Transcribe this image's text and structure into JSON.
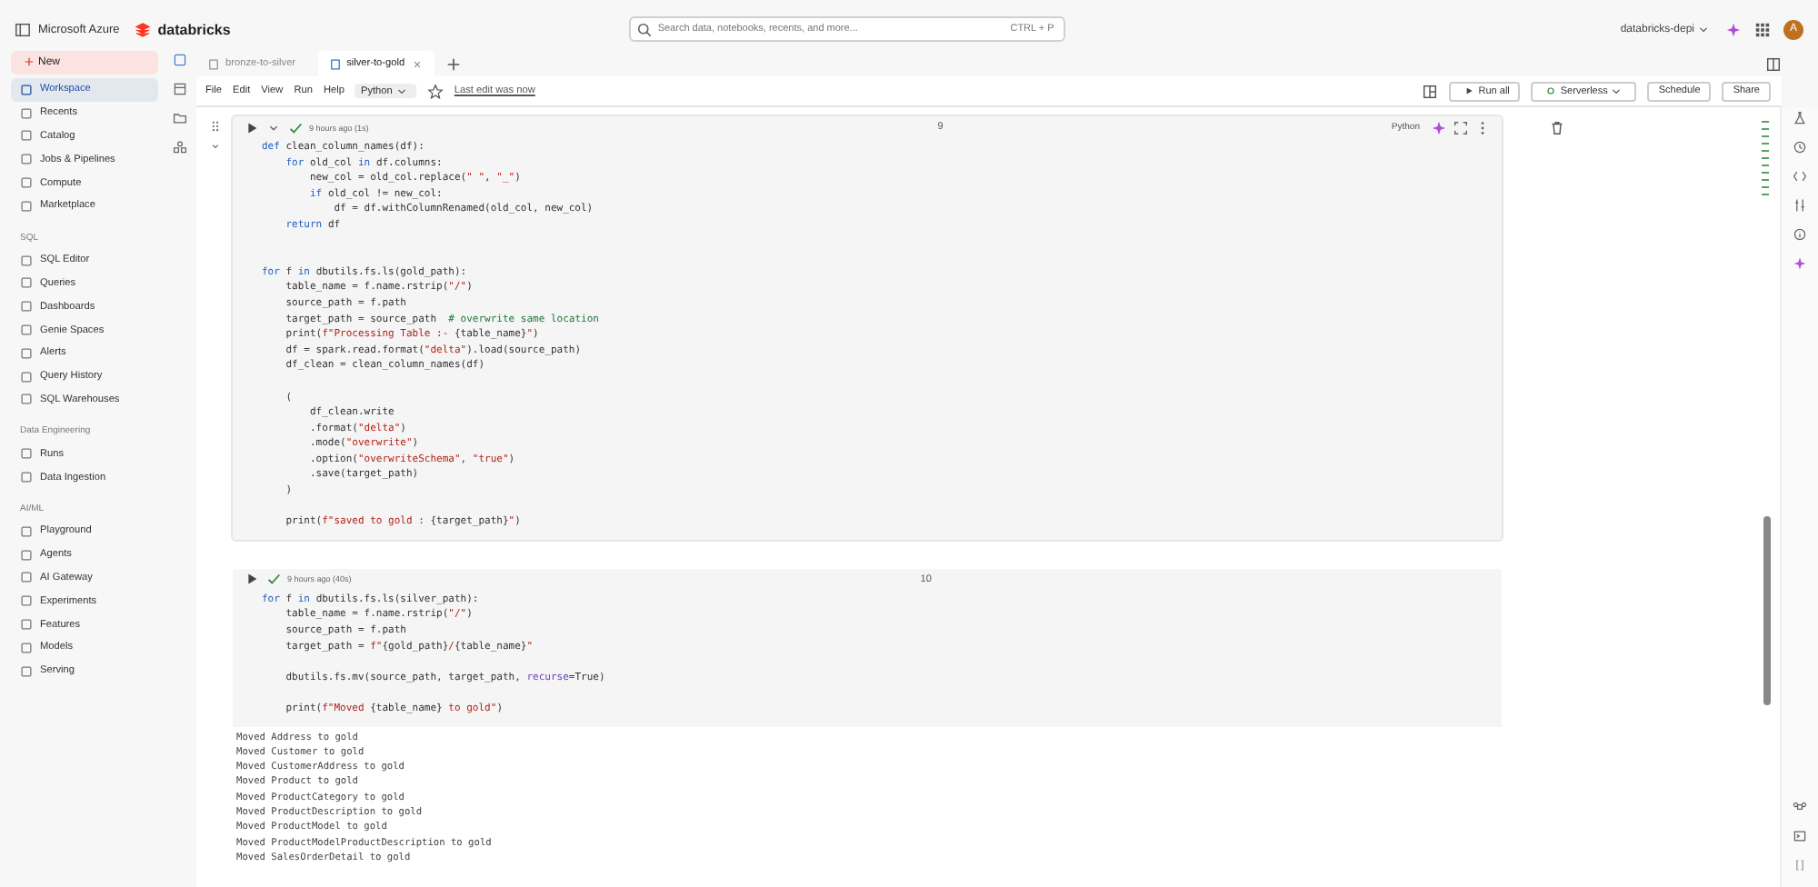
{
  "topbar": {
    "brand": "Microsoft Azure",
    "product": "databricks",
    "search_placeholder": "Search data, notebooks, recents, and more...",
    "shortcut": "CTRL + P",
    "workspace": "databricks-depi",
    "avatar": "A"
  },
  "sidebar": {
    "new_label": "New",
    "sections": [
      {
        "items": [
          {
            "label": "Workspace",
            "selected": true
          },
          {
            "label": "Recents",
            "selected": false
          },
          {
            "label": "Catalog",
            "selected": false
          },
          {
            "label": "Jobs & Pipelines",
            "selected": false
          },
          {
            "label": "Compute",
            "selected": false
          },
          {
            "label": "Marketplace",
            "selected": false
          }
        ]
      },
      {
        "title": "SQL",
        "items": [
          {
            "label": "SQL Editor",
            "selected": false
          },
          {
            "label": "Queries",
            "selected": false
          },
          {
            "label": "Dashboards",
            "selected": false
          },
          {
            "label": "Genie Spaces",
            "selected": false
          },
          {
            "label": "Alerts",
            "selected": false
          },
          {
            "label": "Query History",
            "selected": false
          },
          {
            "label": "SQL Warehouses",
            "selected": false
          }
        ]
      },
      {
        "title": "Data Engineering",
        "items": [
          {
            "label": "Runs",
            "selected": false
          },
          {
            "label": "Data Ingestion",
            "selected": false
          }
        ]
      },
      {
        "title": "AI/ML",
        "items": [
          {
            "label": "Playground",
            "selected": false
          },
          {
            "label": "Agents",
            "selected": false
          },
          {
            "label": "AI Gateway",
            "selected": false
          },
          {
            "label": "Experiments",
            "selected": false
          },
          {
            "label": "Features",
            "selected": false
          },
          {
            "label": "Models",
            "selected": false
          },
          {
            "label": "Serving",
            "selected": false
          }
        ]
      }
    ]
  },
  "tabs": [
    {
      "label": "bronze-to-silver",
      "selected": false
    },
    {
      "label": "silver-to-gold",
      "selected": true
    }
  ],
  "menu": [
    "File",
    "Edit",
    "View",
    "Run",
    "Help"
  ],
  "language": "Python",
  "last_edit": "Last edit was now",
  "toolbar": {
    "run_all": "Run all",
    "compute": "Serverless",
    "schedule": "Schedule",
    "share": "Share"
  },
  "cells": [
    {
      "status": "9 hours ago (1s)",
      "number": "9",
      "language": "Python",
      "hovered": true,
      "lines": [
        {
          "segments": [
            {
              "text": "def ",
              "kind": "keyword"
            },
            {
              "text": "clean_column_names(df):",
              "kind": "plain"
            }
          ]
        },
        {
          "segments": [
            {
              "text": "    for ",
              "kind": "keyword"
            },
            {
              "text": "old_col ",
              "kind": "plain"
            },
            {
              "text": "in ",
              "kind": "keyword"
            },
            {
              "text": "df.columns:",
              "kind": "plain"
            }
          ]
        },
        {
          "segments": [
            {
              "text": "        new_col = old_col.replace(",
              "kind": "plain"
            },
            {
              "text": "\" \"",
              "kind": "string"
            },
            {
              "text": ", ",
              "kind": "plain"
            },
            {
              "text": "\"_\"",
              "kind": "string"
            },
            {
              "text": ")",
              "kind": "plain"
            }
          ]
        },
        {
          "segments": [
            {
              "text": "        if ",
              "kind": "keyword"
            },
            {
              "text": "old_col != new_col:",
              "kind": "plain"
            }
          ]
        },
        {
          "segments": [
            {
              "text": "            df = df.withColumnRenamed(old_col, new_col)",
              "kind": "plain"
            }
          ]
        },
        {
          "segments": [
            {
              "text": "    return ",
              "kind": "keyword"
            },
            {
              "text": "df",
              "kind": "plain"
            }
          ]
        },
        {
          "blank_before": true,
          "extra_blank": true,
          "segments": [
            {
              "text": "for ",
              "kind": "keyword"
            },
            {
              "text": "f ",
              "kind": "plain"
            },
            {
              "text": "in ",
              "kind": "keyword"
            },
            {
              "text": "dbutils.fs.ls(gold_path):",
              "kind": "plain"
            }
          ]
        },
        {
          "segments": [
            {
              "text": "    table_name = f.name.rstrip(",
              "kind": "plain"
            },
            {
              "text": "\"/\"",
              "kind": "string"
            },
            {
              "text": ")",
              "kind": "plain"
            }
          ]
        },
        {
          "segments": [
            {
              "text": "    source_path = f.path",
              "kind": "plain"
            }
          ]
        },
        {
          "segments": [
            {
              "text": "    target_path = source_path  ",
              "kind": "plain"
            },
            {
              "text": "# overwrite same location",
              "kind": "comment"
            }
          ]
        },
        {
          "segments": [
            {
              "text": "    print(",
              "kind": "plain"
            },
            {
              "text": "f\"Processing Table :- ",
              "kind": "string"
            },
            {
              "text": "{table_name}",
              "kind": "plain"
            },
            {
              "text": "\"",
              "kind": "string"
            },
            {
              "text": ")",
              "kind": "plain"
            }
          ]
        },
        {
          "segments": [
            {
              "text": "    df = spark.read.format(",
              "kind": "plain"
            },
            {
              "text": "\"delta\"",
              "kind": "string"
            },
            {
              "text": ").load(source_path)",
              "kind": "plain"
            }
          ]
        },
        {
          "segments": [
            {
              "text": "    df_clean = clean_column_names(df)",
              "kind": "plain"
            }
          ]
        },
        {
          "blank_before": true,
          "segments": [
            {
              "text": "    (",
              "kind": "plain"
            }
          ]
        },
        {
          "segments": [
            {
              "text": "        df_clean.write",
              "kind": "plain"
            }
          ]
        },
        {
          "segments": [
            {
              "text": "        .format(",
              "kind": "plain"
            },
            {
              "text": "\"delta\"",
              "kind": "string"
            },
            {
              "text": ")",
              "kind": "plain"
            }
          ]
        },
        {
          "segments": [
            {
              "text": "        .mode(",
              "kind": "plain"
            },
            {
              "text": "\"overwrite\"",
              "kind": "string"
            },
            {
              "text": ")",
              "kind": "plain"
            }
          ]
        },
        {
          "segments": [
            {
              "text": "        .option(",
              "kind": "plain"
            },
            {
              "text": "\"overwriteSchema\"",
              "kind": "string"
            },
            {
              "text": ", ",
              "kind": "plain"
            },
            {
              "text": "\"true\"",
              "kind": "string"
            },
            {
              "text": ")",
              "kind": "plain"
            }
          ]
        },
        {
          "segments": [
            {
              "text": "        .save(target_path)",
              "kind": "plain"
            }
          ]
        },
        {
          "segments": [
            {
              "text": "    )",
              "kind": "plain"
            }
          ]
        },
        {
          "blank_before": true,
          "segments": [
            {
              "text": "    print(",
              "kind": "plain"
            },
            {
              "text": "f\"saved to gold : ",
              "kind": "string"
            },
            {
              "text": "{target_path}",
              "kind": "plain"
            },
            {
              "text": "\"",
              "kind": "string"
            },
            {
              "text": ")",
              "kind": "plain"
            }
          ]
        }
      ]
    },
    {
      "status": "9 hours ago (40s)",
      "number": "10",
      "hovered": false,
      "lines": [
        {
          "segments": [
            {
              "text": "for ",
              "kind": "keyword"
            },
            {
              "text": "f ",
              "kind": "plain"
            },
            {
              "text": "in ",
              "kind": "keyword"
            },
            {
              "text": "dbutils.fs.ls(silver_path):",
              "kind": "plain"
            }
          ]
        },
        {
          "segments": [
            {
              "text": "    table_name = f.name.rstrip(",
              "kind": "plain"
            },
            {
              "text": "\"/\"",
              "kind": "string"
            },
            {
              "text": ")",
              "kind": "plain"
            }
          ]
        },
        {
          "segments": [
            {
              "text": "    source_path = f.path",
              "kind": "plain"
            }
          ]
        },
        {
          "segments": [
            {
              "text": "    target_path = ",
              "kind": "plain"
            },
            {
              "text": "f\"",
              "kind": "string"
            },
            {
              "text": "{gold_path}",
              "kind": "plain"
            },
            {
              "text": "/",
              "kind": "string"
            },
            {
              "text": "{table_name}",
              "kind": "plain"
            },
            {
              "text": "\"",
              "kind": "string"
            }
          ]
        },
        {
          "blank_before": true,
          "segments": [
            {
              "text": "    dbutils.fs.mv(source_path, target_path, ",
              "kind": "plain"
            },
            {
              "text": "recurse",
              "kind": "argument"
            },
            {
              "text": "=True)",
              "kind": "plain"
            }
          ]
        },
        {
          "blank_before": true,
          "segments": [
            {
              "text": "    print(",
              "kind": "plain"
            },
            {
              "text": "f\"Moved ",
              "kind": "string"
            },
            {
              "text": "{table_name}",
              "kind": "plain"
            },
            {
              "text": " to gold\"",
              "kind": "string"
            },
            {
              "text": ")",
              "kind": "plain"
            }
          ]
        }
      ],
      "output": [
        "Moved Address to gold",
        "Moved Customer to gold",
        "Moved CustomerAddress to gold",
        "Moved Product to gold",
        "Moved ProductCategory to gold",
        "Moved ProductDescription to gold",
        "Moved ProductModel to gold",
        "Moved ProductModelProductDescription to gold",
        "Moved SalesOrderDetail to gold"
      ]
    }
  ]
}
